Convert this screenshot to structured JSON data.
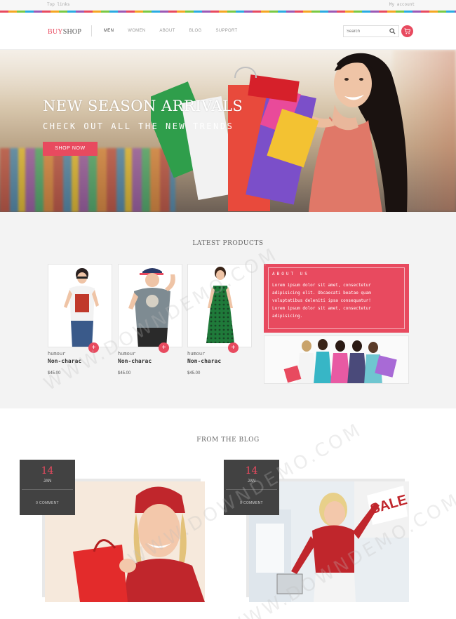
{
  "topbar": {
    "left_text": "Top links",
    "right_text": "My account"
  },
  "brand": {
    "part1": "BUY",
    "part2": "SHOP",
    "accent": "#e84a5f"
  },
  "nav": {
    "items": [
      "MEN",
      "WOMEN",
      "ABOUT",
      "BLOG",
      "SUPPORT"
    ],
    "active": "MEN"
  },
  "search": {
    "placeholder": "Search"
  },
  "hero": {
    "title": "NEW SEASON ARRIVALS",
    "subtitle": "CHECK OUT ALL THE NEW TRENDS",
    "button": "SHOP NOW"
  },
  "latest": {
    "title": "LATEST PRODUCTS",
    "products": [
      {
        "category": "humour",
        "name": "Non-charac",
        "price": "$45.00"
      },
      {
        "category": "humour",
        "name": "Non-charac",
        "price": "$45.00"
      },
      {
        "category": "humour",
        "name": "Non-charac",
        "price": "$45.00"
      }
    ],
    "about": {
      "heading": "ABOUT US",
      "text": "Lorem ipsum dolor sit amet, consectetur adipisicing elit. Obcaecati beatae quam voluptatibus deleniti ipsa consequatur! Lorem ipsum dolor sit amet, consectetur adipisicing."
    }
  },
  "blog": {
    "title": "FROM THE BLOG",
    "posts": [
      {
        "day": "14",
        "month": "JAN",
        "comments": "0 COMMENT"
      },
      {
        "day": "14",
        "month": "JAN",
        "comments": "0 COMMENT"
      }
    ]
  },
  "watermark": "WWW.DOWNDEMO.COM"
}
